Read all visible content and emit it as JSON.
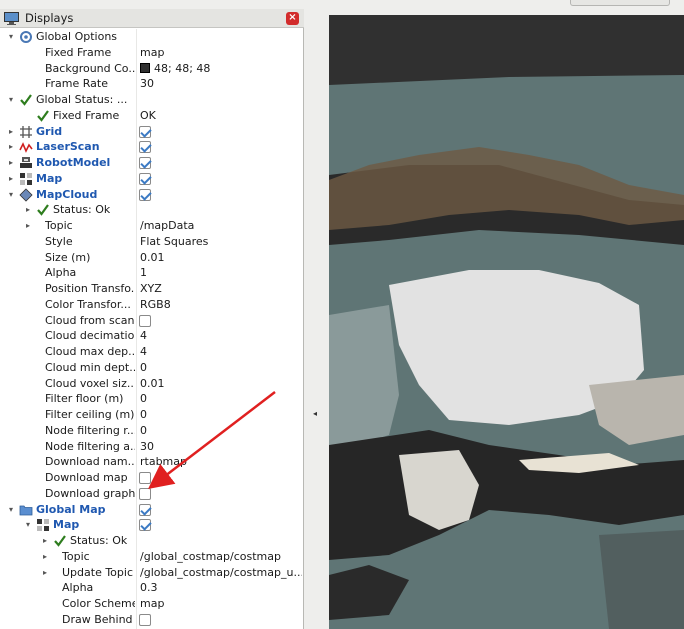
{
  "window": {
    "panel_title": "Displays",
    "close_symbol": "×"
  },
  "colors": {
    "display_name": "#1f58b0",
    "status_ok": "#2e7d1e",
    "bg_swatch": "#303030",
    "annotation_arrow": "#e02020",
    "map_free": "#e2e2e2",
    "map_unknown": "#5f7575"
  },
  "tree": [
    {
      "id": "global-options",
      "level": 0,
      "arrow": "▾",
      "icon": "gear-icon",
      "label": "Global Options"
    },
    {
      "id": "fixed-frame",
      "level": 1,
      "label": "Fixed Frame",
      "value": "map"
    },
    {
      "id": "background-color",
      "level": 1,
      "label": "Background Co...",
      "value": "48; 48; 48",
      "swatch": true
    },
    {
      "id": "frame-rate",
      "level": 1,
      "label": "Frame Rate",
      "value": "30"
    },
    {
      "id": "global-status",
      "level": 0,
      "arrow": "▾",
      "icon": "check-icon",
      "label": "Global Status: ..."
    },
    {
      "id": "fixed-frame-status",
      "level": 1,
      "icon": "check-icon",
      "label": "Fixed Frame",
      "value": "OK"
    },
    {
      "id": "grid",
      "level": 0,
      "arrow": "▸",
      "icon": "grid-icon",
      "label": "Grid",
      "display": true,
      "checked": true
    },
    {
      "id": "laserscan",
      "level": 0,
      "arrow": "▸",
      "icon": "laserscan-icon",
      "label": "LaserScan",
      "display": true,
      "checked": true
    },
    {
      "id": "robotmodel",
      "level": 0,
      "arrow": "▸",
      "icon": "robot-icon",
      "label": "RobotModel",
      "display": true,
      "checked": true
    },
    {
      "id": "map",
      "level": 0,
      "arrow": "▸",
      "icon": "map-icon",
      "label": "Map",
      "display": true,
      "checked": true
    },
    {
      "id": "mapcloud",
      "level": 0,
      "arrow": "▾",
      "icon": "cloud-icon",
      "label": "MapCloud",
      "display": true,
      "checked": true
    },
    {
      "id": "mapcloud-status",
      "level": 1,
      "arrow": "▸",
      "icon": "check-icon",
      "label": "Status: Ok"
    },
    {
      "id": "topic",
      "level": 1,
      "arrow": "▸",
      "label": "Topic",
      "value": "/mapData"
    },
    {
      "id": "style",
      "level": 1,
      "label": "Style",
      "value": "Flat Squares"
    },
    {
      "id": "size",
      "level": 1,
      "label": "Size (m)",
      "value": "0.01"
    },
    {
      "id": "alpha",
      "level": 1,
      "label": "Alpha",
      "value": "1"
    },
    {
      "id": "position-transform",
      "level": 1,
      "label": "Position Transfo...",
      "value": "XYZ"
    },
    {
      "id": "color-transform",
      "level": 1,
      "label": "Color Transfor...",
      "value": "RGB8"
    },
    {
      "id": "cloud-from-scan",
      "level": 1,
      "label": "Cloud from scan",
      "checked": false
    },
    {
      "id": "cloud-decimation",
      "level": 1,
      "label": "Cloud decimation",
      "value": "4"
    },
    {
      "id": "cloud-max-depth",
      "level": 1,
      "label": "Cloud max dep...",
      "value": "4"
    },
    {
      "id": "cloud-min-depth",
      "level": 1,
      "label": "Cloud min dept...",
      "value": "0"
    },
    {
      "id": "cloud-voxel-size",
      "level": 1,
      "label": "Cloud voxel siz...",
      "value": "0.01"
    },
    {
      "id": "filter-floor",
      "level": 1,
      "label": "Filter floor (m)",
      "value": "0"
    },
    {
      "id": "filter-ceiling",
      "level": 1,
      "label": "Filter ceiling (m)",
      "value": "0"
    },
    {
      "id": "node-filtering-radius",
      "level": 1,
      "label": "Node filtering r...",
      "value": "0"
    },
    {
      "id": "node-filtering-angle",
      "level": 1,
      "label": "Node filtering a...",
      "value": "30"
    },
    {
      "id": "download-namespace",
      "level": 1,
      "label": "Download nam...",
      "value": "rtabmap"
    },
    {
      "id": "download-map",
      "level": 1,
      "label": "Download map",
      "checked": false
    },
    {
      "id": "download-graph",
      "level": 1,
      "label": "Download graph",
      "checked": false
    },
    {
      "id": "global-map",
      "level": 0,
      "arrow": "▾",
      "icon": "folder-icon",
      "label": "Global Map",
      "display": true,
      "checked": true
    },
    {
      "id": "global-map-map",
      "level": 1,
      "arrow": "▾",
      "icon": "map-icon",
      "label": "Map",
      "display": true,
      "checked": true
    },
    {
      "id": "global-map-status",
      "level": 2,
      "arrow": "▸",
      "icon": "check-icon",
      "label": "Status: Ok"
    },
    {
      "id": "global-map-topic",
      "level": 2,
      "arrow": "▸",
      "label": "Topic",
      "value": "/global_costmap/costmap"
    },
    {
      "id": "update-topic",
      "level": 2,
      "arrow": "▸",
      "label": "Update Topic",
      "value": "/global_costmap/costmap_u..."
    },
    {
      "id": "global-map-alpha",
      "level": 2,
      "label": "Alpha",
      "value": "0.3"
    },
    {
      "id": "color-scheme",
      "level": 2,
      "label": "Color Scheme",
      "value": "map"
    },
    {
      "id": "draw-behind",
      "level": 2,
      "label": "Draw Behind",
      "checked": false
    }
  ]
}
